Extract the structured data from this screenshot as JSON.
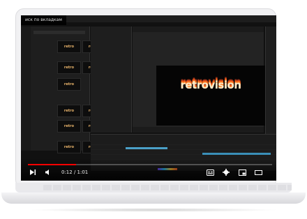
{
  "video": {
    "title_overlay": "иск по вкладкам",
    "current_time": "0:12",
    "duration": "1:01",
    "time_display": "0:12 / 1:01",
    "progress": 0.197
  },
  "app": {
    "logo_text": "retrovision",
    "thumbnails": [
      {
        "label": "retro"
      },
      {
        "label": "retro"
      },
      {
        "label": "retro"
      },
      {
        "label": "retro"
      },
      {
        "label": "retro"
      },
      {
        "label": "retro"
      },
      {
        "label": "retro"
      },
      {
        "label": "retro"
      },
      {
        "label": "retro"
      },
      {
        "label": "retro"
      },
      {
        "label": "retro"
      },
      {
        "label": "retro"
      }
    ]
  },
  "icons": [
    "next-icon",
    "volume-icon",
    "subtitles-icon",
    "settings-icon",
    "miniplayer-icon",
    "theater-icon"
  ],
  "colors": {
    "progress": "#ff0000",
    "accent": "#ff8a2a",
    "panel": "#1e1e1e"
  }
}
